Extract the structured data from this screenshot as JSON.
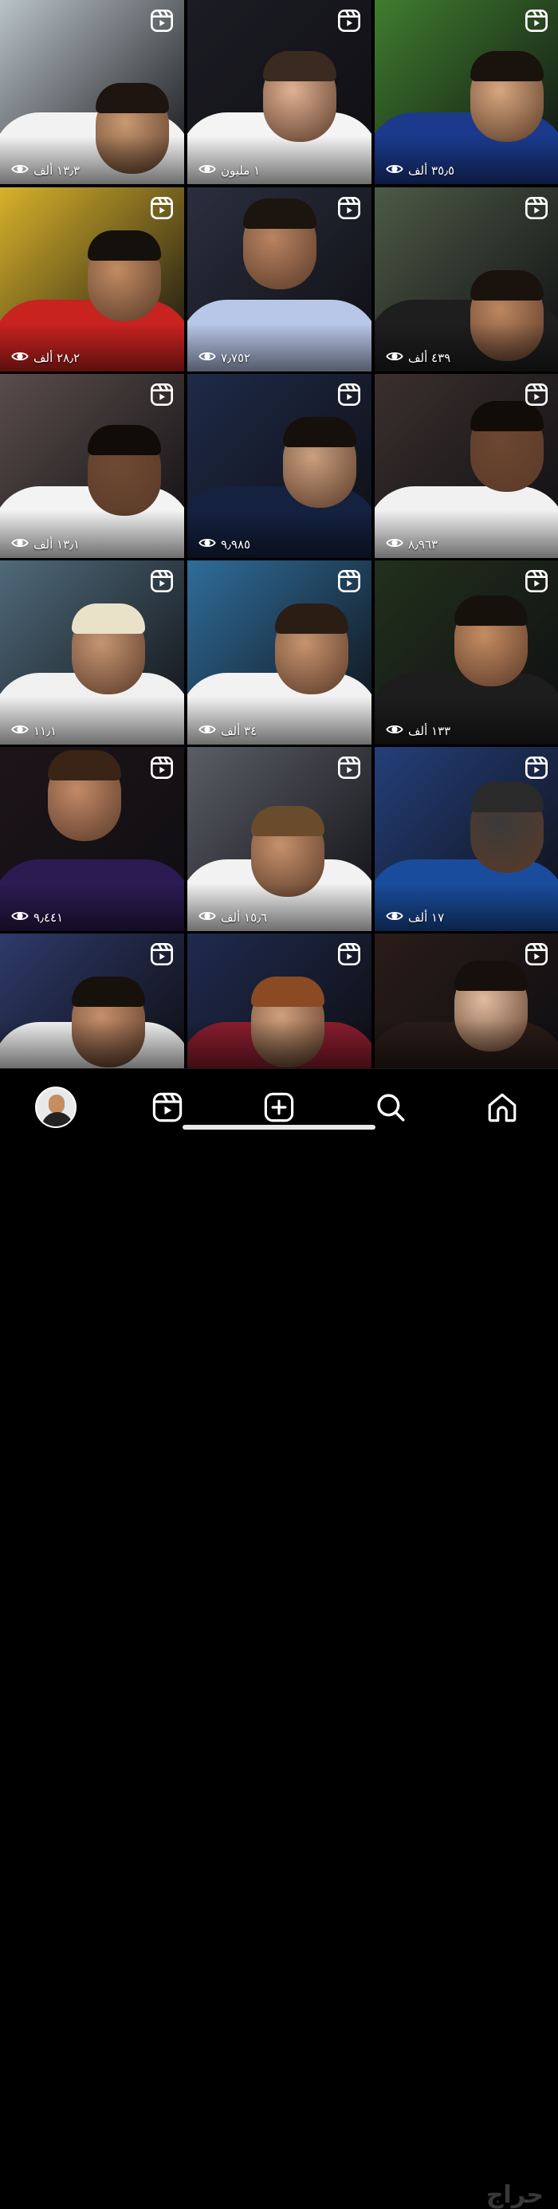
{
  "reels": [
    {
      "views": "١٣٫٣ ألف",
      "bg": "#b9c3c8",
      "skin": "#c99a72",
      "hair": "#1e1410",
      "jersey": "#f2f2f2"
    },
    {
      "views": "١ مليون",
      "bg": "#1c1c24",
      "skin": "#e0b293",
      "hair": "#3a2a1f",
      "jersey": "#f4f4f4"
    },
    {
      "views": "٣٥٫٥ ألف",
      "bg": "#3f7d2e",
      "skin": "#d7a77f",
      "hair": "#1a120d",
      "jersey": "#1b3a8c"
    },
    {
      "views": "٢٨٫٢ ألف",
      "bg": "#d8b22a",
      "skin": "#c18c63",
      "hair": "#14100c",
      "jersey": "#c8231f"
    },
    {
      "views": "٧٫٧٥٢",
      "bg": "#2a2e3e",
      "skin": "#b98462",
      "hair": "#1b140f",
      "jersey": "#b8c6e8"
    },
    {
      "views": "٤٣٩ ألف",
      "bg": "#4d5a46",
      "skin": "#bd8660",
      "hair": "#1a120d",
      "jersey": "#1e1e1e"
    },
    {
      "views": "١٣٫١ ألف",
      "bg": "#5a4d4a",
      "skin": "#6e4a33",
      "hair": "#120c08",
      "jersey": "#f3f3f3"
    },
    {
      "views": "٩٫٩٨٥",
      "bg": "#1e2a48",
      "skin": "#caa07f",
      "hair": "#15100c",
      "jersey": "#14213f"
    },
    {
      "views": "٨٫٩٦٣",
      "bg": "#3a2f2d",
      "skin": "#6c4731",
      "hair": "#120c08",
      "jersey": "#f1f1f1"
    },
    {
      "views": "١١٫١",
      "bg": "#4f6a7a",
      "skin": "#c69673",
      "hair": "#e9e1c8",
      "jersey": "#f0f0f0"
    },
    {
      "views": "٣٤ ألف",
      "bg": "#2f6d9a",
      "skin": "#c79470",
      "hair": "#2a1d14",
      "jersey": "#f2f2f2"
    },
    {
      "views": "١٣٣ ألف",
      "bg": "#22301c",
      "skin": "#c58c62",
      "hair": "#17110c",
      "jersey": "#1d1d1d"
    },
    {
      "views": "٩٫٤٤١",
      "bg": "#1d1418",
      "skin": "#c48a69",
      "hair": "#3a2416",
      "jersey": "#2b1b52"
    },
    {
      "views": "١٥٫٦ ألف",
      "bg": "#5b5d66",
      "skin": "#c6916c",
      "hair": "#6a4c2c",
      "jersey": "#f2f2f2"
    },
    {
      "views": "١٧ ألف",
      "bg": "#243f7a",
      "skin": "#3a3a3a",
      "hair": "#2a2a2a",
      "jersey": "#1a4c9e"
    },
    {
      "views": "",
      "bg": "#2e3a6a",
      "skin": "#c58f6b",
      "hair": "#17110c",
      "jersey": "#f1f1f1"
    },
    {
      "views": "",
      "bg": "#1f2a4f",
      "skin": "#d0a07c",
      "hair": "#8a4a24",
      "jersey": "#8a1d2e"
    },
    {
      "views": "",
      "bg": "#2a1c18",
      "skin": "#e2bca0",
      "hair": "#160f0c",
      "jersey": "#2a1c18"
    }
  ],
  "tabbar": {
    "items": [
      "profile",
      "reels",
      "create",
      "search",
      "home"
    ]
  },
  "watermark": "حراج"
}
